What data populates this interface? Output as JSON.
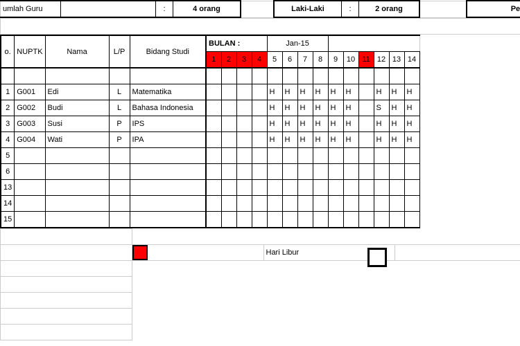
{
  "summary": {
    "jumlah_guru_label": "umlah Guru",
    "jumlah_guru_value": "4 orang",
    "laki_label": "Laki-Laki",
    "laki_value": "2 orang",
    "perempuan_label": "Peren",
    "colon": ":"
  },
  "bulan": {
    "label": "BULAN :",
    "value": "Jan-15"
  },
  "headers": {
    "no": "o.",
    "nuptk": "NUPTK",
    "nama": "Nama",
    "lp": "L/P",
    "bidang": "Bidang Studi"
  },
  "days": [
    "1",
    "2",
    "3",
    "4",
    "5",
    "6",
    "7",
    "8",
    "9",
    "10",
    "11",
    "12",
    "13",
    "14"
  ],
  "holiday_idx": [
    0,
    1,
    2,
    3,
    10
  ],
  "rows": [
    {
      "no": "1",
      "nuptk": "G001",
      "nama": "Edi",
      "lp": "L",
      "bidang": "Matematika",
      "att": [
        "",
        "",
        "",
        "",
        "H",
        "H",
        "H",
        "H",
        "H",
        "H",
        "",
        "H",
        "H",
        "H"
      ]
    },
    {
      "no": "2",
      "nuptk": "G002",
      "nama": "Budi",
      "lp": "L",
      "bidang": "Bahasa Indonesia",
      "att": [
        "",
        "",
        "",
        "",
        "H",
        "H",
        "H",
        "H",
        "H",
        "H",
        "",
        "S",
        "H",
        "H"
      ]
    },
    {
      "no": "3",
      "nuptk": "G003",
      "nama": "Susi",
      "lp": "P",
      "bidang": "IPS",
      "att": [
        "",
        "",
        "",
        "",
        "H",
        "H",
        "H",
        "H",
        "H",
        "H",
        "",
        "H",
        "H",
        "H"
      ]
    },
    {
      "no": "4",
      "nuptk": "G004",
      "nama": "Wati",
      "lp": "P",
      "bidang": "IPA",
      "att": [
        "",
        "",
        "",
        "",
        "H",
        "H",
        "H",
        "H",
        "H",
        "H",
        "",
        "H",
        "H",
        "H"
      ]
    },
    {
      "no": "5",
      "nuptk": "",
      "nama": "",
      "lp": "",
      "bidang": "",
      "att": [
        "",
        "",
        "",
        "",
        "",
        "",
        "",
        "",
        "",
        "",
        "",
        "",
        "",
        ""
      ]
    },
    {
      "no": "6",
      "nuptk": "",
      "nama": "",
      "lp": "",
      "bidang": "",
      "att": [
        "",
        "",
        "",
        "",
        "",
        "",
        "",
        "",
        "",
        "",
        "",
        "",
        "",
        ""
      ]
    },
    {
      "no": "13",
      "nuptk": "",
      "nama": "",
      "lp": "",
      "bidang": "",
      "att": [
        "",
        "",
        "",
        "",
        "",
        "",
        "",
        "",
        "",
        "",
        "",
        "",
        "",
        ""
      ]
    },
    {
      "no": "14",
      "nuptk": "",
      "nama": "",
      "lp": "",
      "bidang": "",
      "att": [
        "",
        "",
        "",
        "",
        "",
        "",
        "",
        "",
        "",
        "",
        "",
        "",
        "",
        ""
      ]
    },
    {
      "no": "15",
      "nuptk": "",
      "nama": "",
      "lp": "",
      "bidang": "",
      "att": [
        "",
        "",
        "",
        "",
        "",
        "",
        "",
        "",
        "",
        "",
        "",
        "",
        "",
        ""
      ]
    }
  ],
  "legend": {
    "hari_libur": "Hari Libur"
  }
}
